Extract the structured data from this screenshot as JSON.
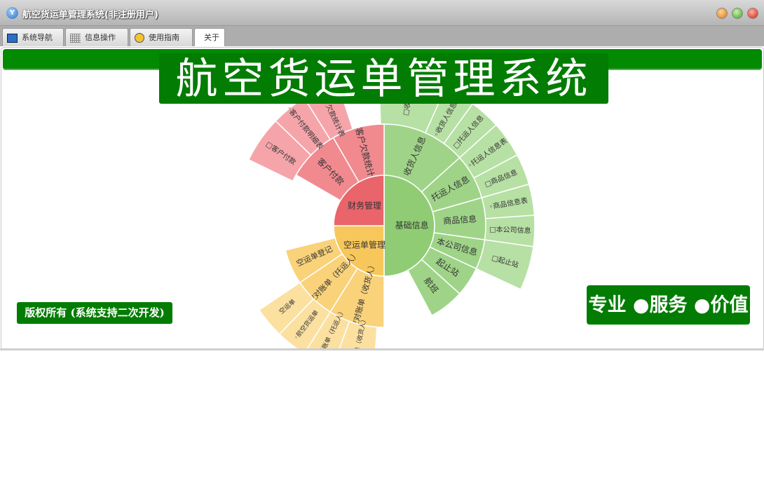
{
  "window": {
    "title": "航空货运单管理系统(非注册用户)"
  },
  "tabs": [
    {
      "label": "系统导航",
      "icon": "monitor-icon"
    },
    {
      "label": "信息操作",
      "icon": "grid-icon"
    },
    {
      "label": "使用指南",
      "icon": "guide-icon"
    },
    {
      "label": "关于",
      "icon": ""
    }
  ],
  "banner": {
    "title": "航空货运单管理系统"
  },
  "copyright": "版权所有 (系统支持二次开发)",
  "slogan": "专业 ●服务 ●价值",
  "colors": {
    "green": "#027c02",
    "finance": "#e9646b",
    "waybill": "#f8c75b",
    "base": "#8fcc74"
  },
  "sunburst": {
    "finance": {
      "label": "财务管理",
      "ring2": [
        "客户付款",
        "客户欠款统计"
      ],
      "ring3": [
        "□客户付款",
        "◦客户付款明细表",
        "□客户欠款统计表"
      ]
    },
    "waybill": {
      "label": "空运单管理",
      "ring2": [
        "航空对账单（收货人）",
        "航空对账单（托运人）",
        "空运单登记"
      ],
      "ring3": [
        "◦航空对账单（收货人）",
        "◦航空对账单（托运人）",
        "◦航空货运单",
        "空运单"
      ]
    },
    "base": {
      "label": "基础信息",
      "ring2": [
        "收货人信息",
        "托运人信息",
        "商品信息",
        "本公司信息",
        "起止站",
        "航班"
      ],
      "ring3": [
        "□收货人",
        "◦收货人信息表",
        "□托运人信息",
        "◦托运人信息表",
        "□商品信息",
        "◦商品信息表",
        "□本公司信息",
        "□起止站"
      ]
    }
  }
}
